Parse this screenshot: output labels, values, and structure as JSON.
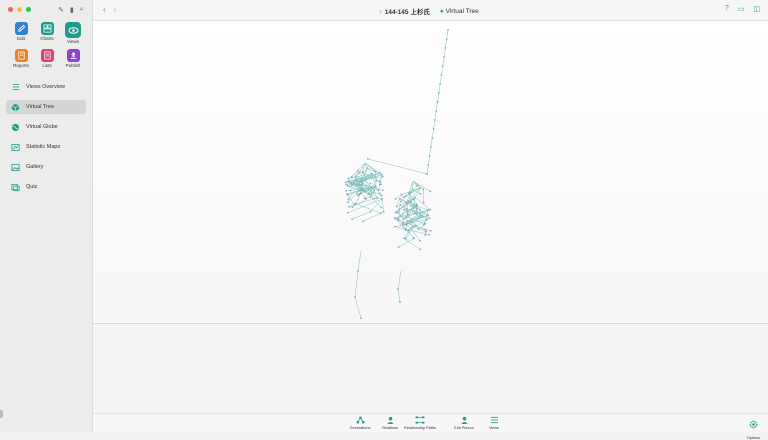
{
  "sidebar": {
    "tools": [
      {
        "label": "Edit",
        "icon": "pencil-icon",
        "color": "#2f80d8"
      },
      {
        "label": "Charts",
        "icon": "charts-icon",
        "color": "#1e9c8e"
      },
      {
        "label": "Views",
        "icon": "eye-icon",
        "color": "#1e9c8e"
      },
      {
        "label": "Reports",
        "icon": "reports-icon",
        "color": "#e6822a"
      },
      {
        "label": "Lists",
        "icon": "lists-icon",
        "color": "#d6457a"
      },
      {
        "label": "Publish",
        "icon": "publish-icon",
        "color": "#8e44c9"
      }
    ],
    "nav": [
      {
        "label": "Views Overview",
        "icon": "list-icon",
        "active": false
      },
      {
        "label": "Virtual Tree",
        "icon": "cube-icon",
        "active": true
      },
      {
        "label": "Virtual Globe",
        "icon": "globe-icon",
        "active": false
      },
      {
        "label": "Statistic Maps",
        "icon": "map-icon",
        "active": false
      },
      {
        "label": "Gallery",
        "icon": "gallery-icon",
        "active": false
      },
      {
        "label": "Quiz",
        "icon": "quiz-icon",
        "active": false
      }
    ]
  },
  "header": {
    "person": "144-145 上杉氏",
    "view": "Virtual Tree"
  },
  "bottombar": {
    "items": [
      {
        "label": "Generations",
        "icon": "generations-icon"
      },
      {
        "label": "Relatives",
        "icon": "relatives-icon"
      },
      {
        "label": "Relationship Paths",
        "icon": "relationship-paths-icon"
      },
      {
        "label": "Edit Person",
        "icon": "edit-person-icon"
      },
      {
        "label": "Views",
        "icon": "views-icon"
      }
    ],
    "options": "Options"
  },
  "colors": {
    "accent": "#1e9c8e",
    "tree_line": "#7fc4be",
    "tree_node": "#8aa3b8"
  }
}
